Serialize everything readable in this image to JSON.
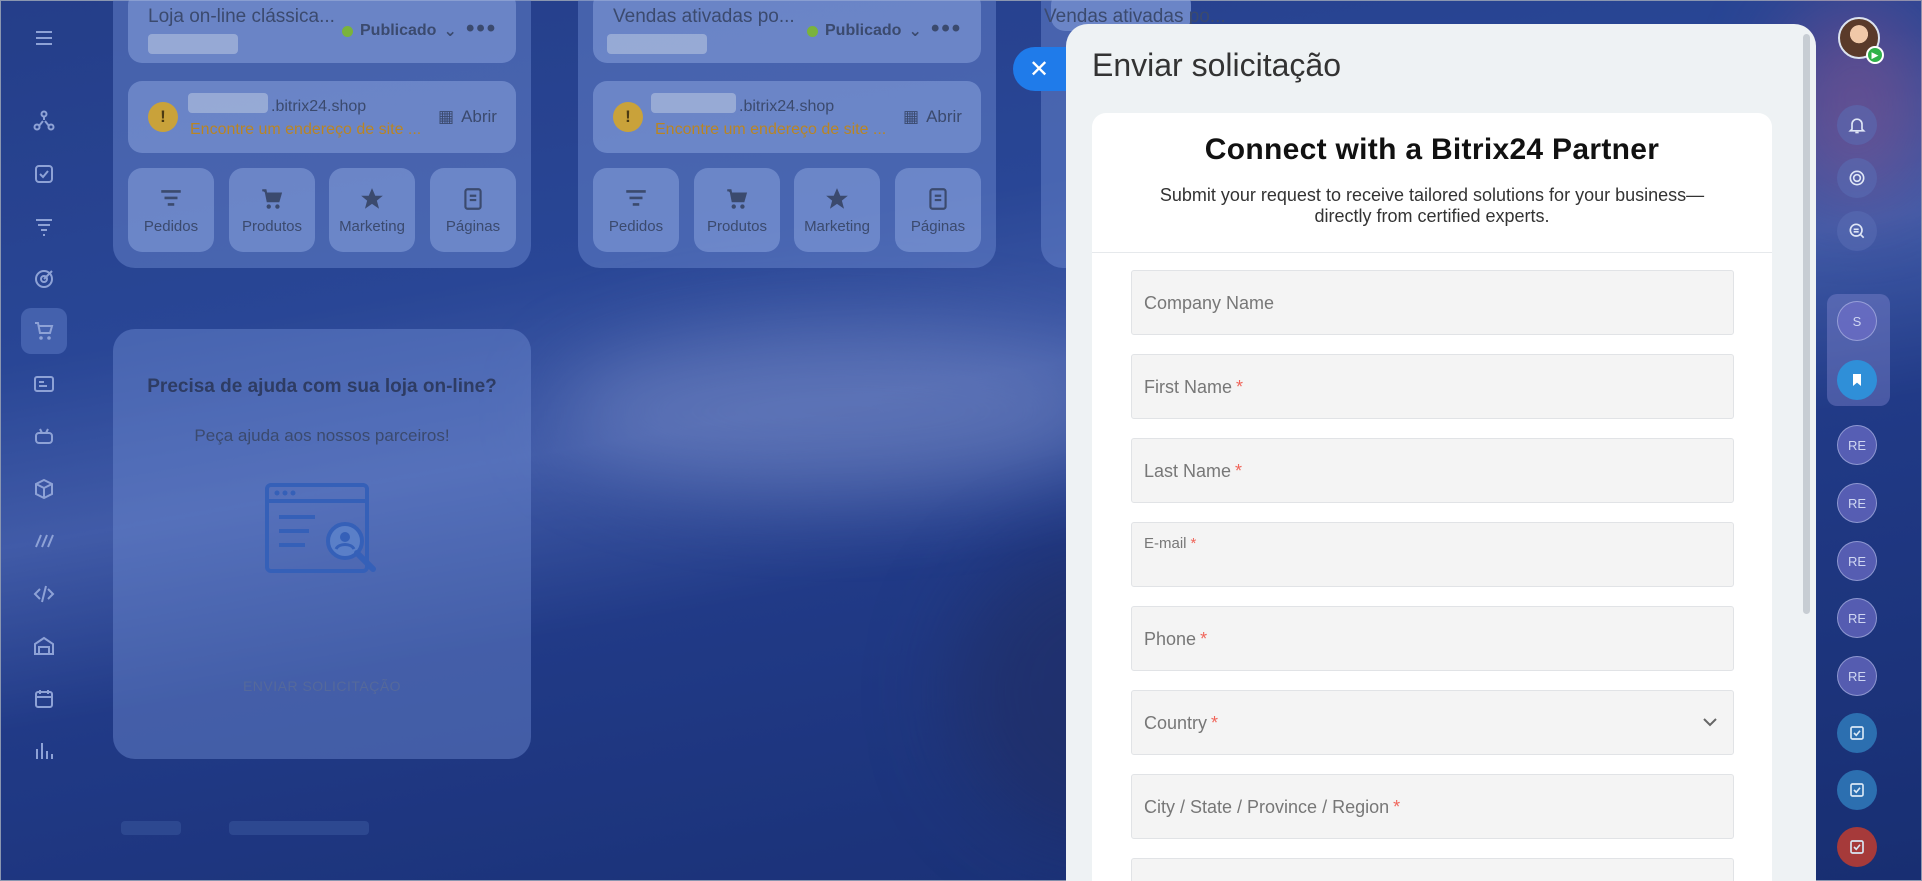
{
  "stores": [
    {
      "title": "Loja on-line clássica...",
      "status": "Publicado",
      "domain": ".bitrix24.shop",
      "warning": "Encontre um endereço de site ...",
      "open_label": "Abrir"
    },
    {
      "title": "Vendas ativadas po...",
      "status": "Publicado",
      "domain": ".bitrix24.shop",
      "warning": "Encontre um endereço de site ...",
      "open_label": "Abrir"
    },
    {
      "title": "Vendas ativadas po..."
    }
  ],
  "tiles": [
    "Pedidos",
    "Produtos",
    "Marketing",
    "Páginas"
  ],
  "help": {
    "title": "Precisa de ajuda com sua loja on-line?",
    "subtitle": "Peça ajuda aos nossos parceiros!",
    "button": "ENVIAR SOLICITAÇÃO"
  },
  "panel": {
    "title": "Enviar solicitação",
    "form_title": "Connect with a Bitrix24 Partner",
    "form_subtitle": "Submit your request to receive tailored solutions for your business—directly from certified experts.",
    "fields": [
      {
        "label": "Company Name",
        "required": false
      },
      {
        "label": "First Name",
        "required": true
      },
      {
        "label": "Last Name",
        "required": true
      },
      {
        "label": "E-mail",
        "required": true
      },
      {
        "label": "Phone",
        "required": true
      },
      {
        "label": "Country",
        "required": true
      },
      {
        "label": "City / State / Province /  Region",
        "required": true
      }
    ],
    "required_mark": "*"
  },
  "right_rail": {
    "avatar_initials": [
      "S",
      "RE",
      "RE",
      "RE",
      "RE",
      "RE"
    ]
  },
  "colors": {
    "accent": "#1f7bea",
    "required": "#f0655a",
    "published_dot": "#7ab33b",
    "warning": "#b98524"
  }
}
